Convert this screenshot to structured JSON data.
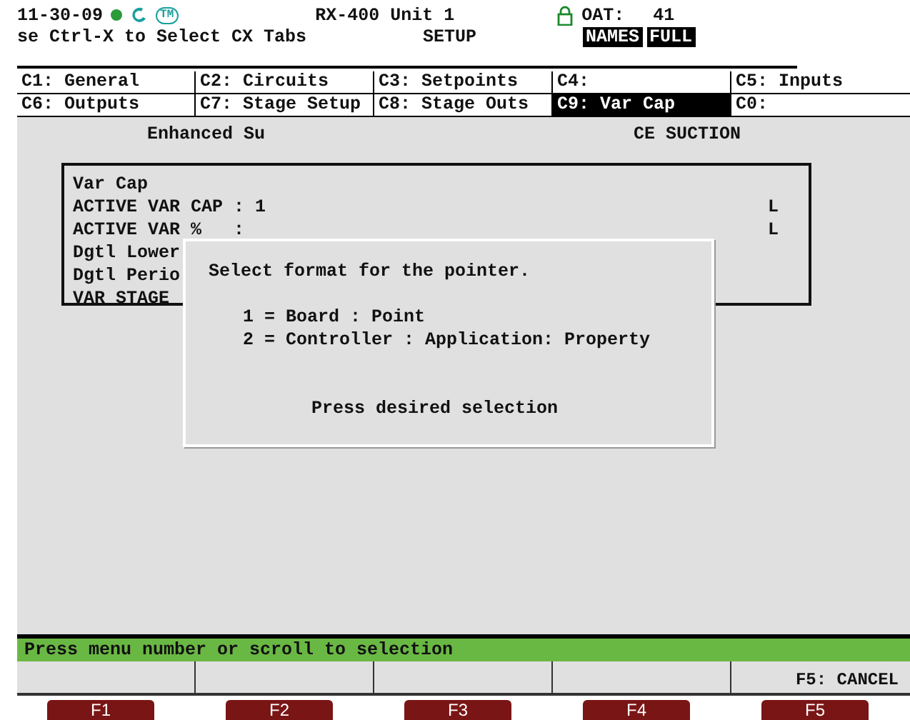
{
  "header": {
    "date": "11-30-09",
    "unit": "RX-400 Unit 1",
    "oat_label": "OAT:",
    "oat_value": "41",
    "tm_badge": "TM",
    "hint": "se Ctrl-X to Select CX Tabs",
    "mode": "SETUP",
    "badges": [
      "NAMES",
      "FULL"
    ]
  },
  "tabs": [
    [
      {
        "label": "C1: General",
        "selected": false
      },
      {
        "label": "C2: Circuits",
        "selected": false
      },
      {
        "label": "C3: Setpoints",
        "selected": false
      },
      {
        "label": "C4:",
        "selected": false
      },
      {
        "label": "C5: Inputs",
        "selected": false
      }
    ],
    [
      {
        "label": "C6: Outputs",
        "selected": false
      },
      {
        "label": "C7: Stage Setup",
        "selected": false
      },
      {
        "label": "C8: Stage Outs",
        "selected": false
      },
      {
        "label": "C9: Var Cap",
        "selected": true
      },
      {
        "label": "C0:",
        "selected": false
      }
    ]
  ],
  "panel": {
    "heading_left": "Enhanced Su",
    "heading_right": "CE SUCTION",
    "lines": [
      {
        "text": "Var Cap"
      },
      {
        "text": "ACTIVE VAR CAP : 1",
        "flag": "L"
      },
      {
        "text": "ACTIVE VAR %   :",
        "flag": "L"
      },
      {
        "text": "Dgtl Lower"
      },
      {
        "text": "Dgtl Perio"
      },
      {
        "text": "VAR STAGE"
      }
    ]
  },
  "dialog": {
    "prompt": "Select format for the pointer.",
    "options": [
      "1 = Board : Point",
      "2 = Controller : Application: Property"
    ],
    "instruction": "Press desired selection"
  },
  "status": "Press menu number or scroll to selection",
  "softkeys": [
    {
      "label": "F5: CANCEL"
    }
  ],
  "hardware_keys": [
    "F1",
    "F2",
    "F3",
    "F4",
    "F5"
  ]
}
